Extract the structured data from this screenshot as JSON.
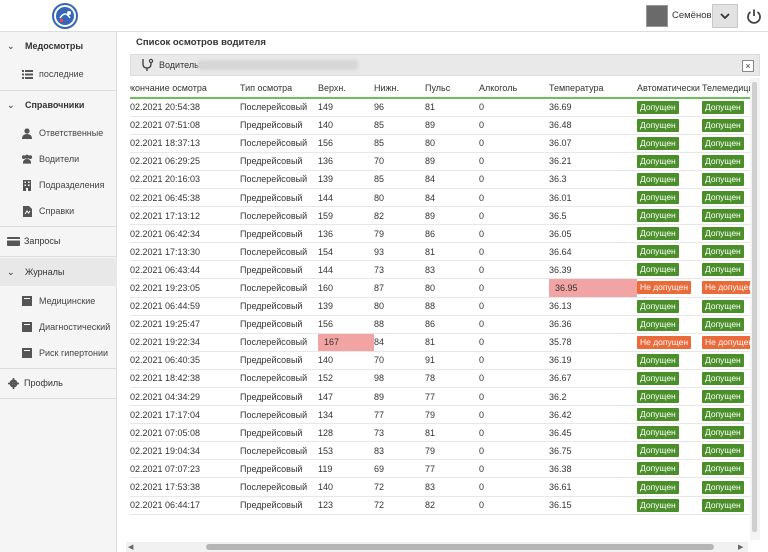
{
  "header": {
    "user_name": "Семёнов...",
    "colors": {
      "brand": "#3566b8"
    }
  },
  "sidebar": {
    "groups": [
      {
        "label": "Медосмотры",
        "items": [
          {
            "label": "последние",
            "icon": "list-icon"
          }
        ]
      },
      {
        "label": "Справочники",
        "items": [
          {
            "label": "Ответственные",
            "icon": "person-icon"
          },
          {
            "label": "Водители",
            "icon": "people-icon"
          },
          {
            "label": "Подразделения",
            "icon": "building-icon"
          },
          {
            "label": "Справки",
            "icon": "document-icon"
          }
        ]
      }
    ],
    "requests": {
      "label": "Запросы",
      "icon": "card-icon"
    },
    "journals": {
      "label": "Журналы",
      "items": [
        {
          "label": "Медицинские",
          "icon": "book-icon"
        },
        {
          "label": "Диагностический",
          "icon": "book-icon"
        },
        {
          "label": "Риск гипертонии",
          "icon": "book-icon"
        }
      ]
    },
    "profile": {
      "label": "Профиль",
      "icon": "gear-icon"
    }
  },
  "main": {
    "title": "Список осмотров водителя",
    "driver_label": "Водитель:",
    "columns": [
      "Окончание осмотра",
      "Тип осмотра",
      "Верхн.",
      "Нижн.",
      "Пульс",
      "Алкоголь",
      "Температура",
      "Автоматически",
      "Телемедицина"
    ],
    "rows": [
      [
        "02.2021 20:54:38",
        "Послерейсовый",
        "149",
        "96",
        "81",
        "0",
        "36.69",
        "Допущен",
        "Допущен"
      ],
      [
        "02.2021 07:51:08",
        "Предрейсовый",
        "140",
        "85",
        "89",
        "0",
        "36.48",
        "Допущен",
        "Допущен"
      ],
      [
        "02.2021 18:37:13",
        "Послерейсовый",
        "156",
        "85",
        "80",
        "0",
        "36.07",
        "Допущен",
        "Допущен"
      ],
      [
        "02.2021 06:29:25",
        "Предрейсовый",
        "136",
        "70",
        "89",
        "0",
        "36.21",
        "Допущен",
        "Допущен"
      ],
      [
        "02.2021 20:16:03",
        "Послерейсовый",
        "139",
        "85",
        "84",
        "0",
        "36.3",
        "Допущен",
        "Допущен"
      ],
      [
        "02.2021 06:45:38",
        "Предрейсовый",
        "144",
        "80",
        "84",
        "0",
        "36.01",
        "Допущен",
        "Допущен"
      ],
      [
        "02.2021 17:13:12",
        "Послерейсовый",
        "159",
        "82",
        "89",
        "0",
        "36.5",
        "Допущен",
        "Допущен"
      ],
      [
        "02.2021 06:42:34",
        "Предрейсовый",
        "136",
        "79",
        "86",
        "0",
        "36.05",
        "Допущен",
        "Допущен"
      ],
      [
        "02.2021 17:13:30",
        "Послерейсовый",
        "154",
        "93",
        "81",
        "0",
        "36.64",
        "Допущен",
        "Допущен"
      ],
      [
        "02.2021 06:43:44",
        "Предрейсовый",
        "144",
        "73",
        "83",
        "0",
        "36.39",
        "Допущен",
        "Допущен"
      ],
      [
        "02.2021 19:23:05",
        "Послерейсовый",
        "160",
        "87",
        "80",
        "0",
        "36.95",
        "Не допущен",
        "Не допущен"
      ],
      [
        "02.2021 06:44:59",
        "Предрейсовый",
        "139",
        "80",
        "88",
        "0",
        "36.13",
        "Допущен",
        "Допущен"
      ],
      [
        "02.2021 19:25:47",
        "Предрейсовый",
        "156",
        "88",
        "86",
        "0",
        "36.36",
        "Допущен",
        "Допущен"
      ],
      [
        "02.2021 19:22:34",
        "Послерейсовый",
        "167",
        "84",
        "81",
        "0",
        "35.78",
        "Не допущен",
        "Не допущен"
      ],
      [
        "02.2021 06:40:35",
        "Предрейсовый",
        "140",
        "70",
        "91",
        "0",
        "36.19",
        "Допущен",
        "Допущен"
      ],
      [
        "02.2021 18:42:38",
        "Послерейсовый",
        "152",
        "98",
        "78",
        "0",
        "36.67",
        "Допущен",
        "Допущен"
      ],
      [
        "02.2021 04:34:29",
        "Предрейсовый",
        "147",
        "89",
        "77",
        "0",
        "36.2",
        "Допущен",
        "Допущен"
      ],
      [
        "02.2021 17:17:04",
        "Послерейсовый",
        "134",
        "77",
        "79",
        "0",
        "36.42",
        "Допущен",
        "Допущен"
      ],
      [
        "02.2021 07:05:08",
        "Предрейсовый",
        "128",
        "73",
        "81",
        "0",
        "36.45",
        "Допущен",
        "Допущен"
      ],
      [
        "02.2021 19:04:34",
        "Послерейсовый",
        "153",
        "83",
        "79",
        "0",
        "36.75",
        "Допущен",
        "Допущен"
      ],
      [
        "02.2021 07:07:23",
        "Предрейсовый",
        "119",
        "69",
        "77",
        "0",
        "36.38",
        "Допущен",
        "Допущен"
      ],
      [
        "02.2021 17:53:38",
        "Послерейсовый",
        "140",
        "72",
        "83",
        "0",
        "36.61",
        "Допущен",
        "Допущен"
      ],
      [
        "02.2021 06:44:17",
        "Предрейсовый",
        "123",
        "72",
        "82",
        "0",
        "36.15",
        "Допущен",
        "Допущен"
      ]
    ],
    "highlight_cells": [
      {
        "row": 10,
        "col": 6
      },
      {
        "row": 13,
        "col": 2
      }
    ],
    "colors": {
      "ok": "#4a8f2a",
      "bad": "#ea6a3a",
      "highlight": "#f2a4a4",
      "header_line": "#6cbf5b"
    }
  }
}
